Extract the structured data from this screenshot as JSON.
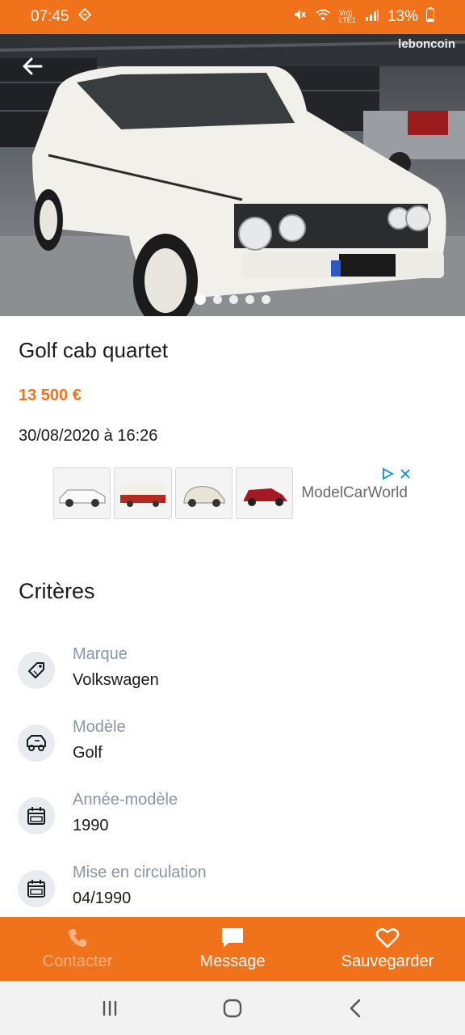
{
  "status_bar": {
    "time": "07:45",
    "battery": "13%",
    "network": "Vo)) LTE1"
  },
  "hero": {
    "watermark": "leboncoin",
    "image_count": 5,
    "active_index": 0
  },
  "listing": {
    "title": "Golf cab quartet",
    "price": "13 500 €",
    "date": "30/08/2020 à 16:26"
  },
  "ad": {
    "brand": "ModelCarWorld"
  },
  "criteria": {
    "heading": "Critères",
    "items": [
      {
        "label": "Marque",
        "value": "Volkswagen",
        "icon": "tag-icon"
      },
      {
        "label": "Modèle",
        "value": "Golf",
        "icon": "car-icon"
      },
      {
        "label": "Année-modèle",
        "value": "1990",
        "icon": "calendar-icon"
      },
      {
        "label": "Mise en circulation",
        "value": "04/1990",
        "icon": "calendar-icon"
      }
    ]
  },
  "actions": {
    "contact": "Contacter",
    "message": "Message",
    "save": "Sauvegarder"
  },
  "colors": {
    "brand": "#f0731c",
    "label_gray": "#8a95a3",
    "icon_bg": "#e8ecf1"
  }
}
